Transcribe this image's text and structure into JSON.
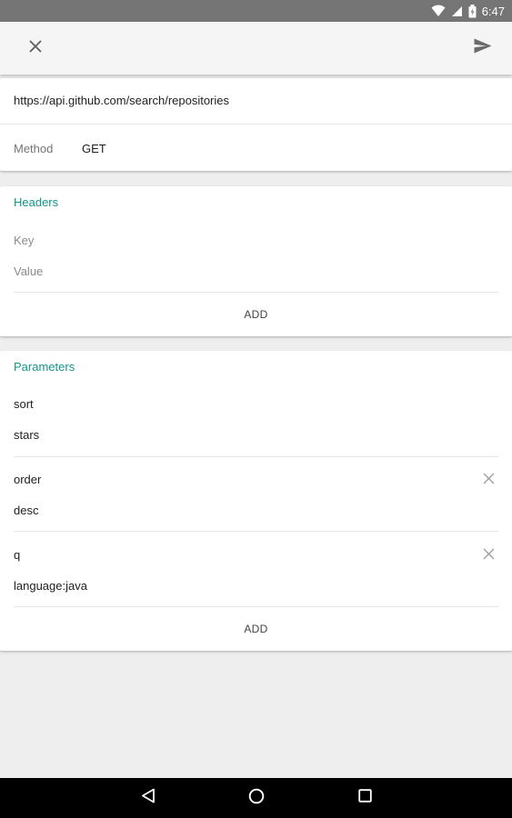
{
  "status_bar": {
    "time": "6:47",
    "icons": [
      "wifi-icon",
      "signal-icon",
      "battery-icon"
    ]
  },
  "app_bar": {
    "close_icon": "close-icon",
    "send_icon": "send-icon"
  },
  "request": {
    "url": "https://api.github.com/search/repositories",
    "method_label": "Method",
    "method_value": "GET"
  },
  "headers_section": {
    "title": "Headers",
    "key_placeholder": "Key",
    "value_placeholder": "Value",
    "add_label": "ADD"
  },
  "params_section": {
    "title": "Parameters",
    "items": [
      {
        "key": "sort",
        "value": "stars",
        "removable": false
      },
      {
        "key": "order",
        "value": "desc",
        "removable": true
      },
      {
        "key": "q",
        "value": "language:java",
        "removable": true
      }
    ],
    "add_label": "ADD"
  },
  "colors": {
    "accent": "#15948a",
    "status_bar": "#757575",
    "app_bar": "#f5f5f5",
    "background": "#eeeeee",
    "nav_bar": "#000000"
  }
}
